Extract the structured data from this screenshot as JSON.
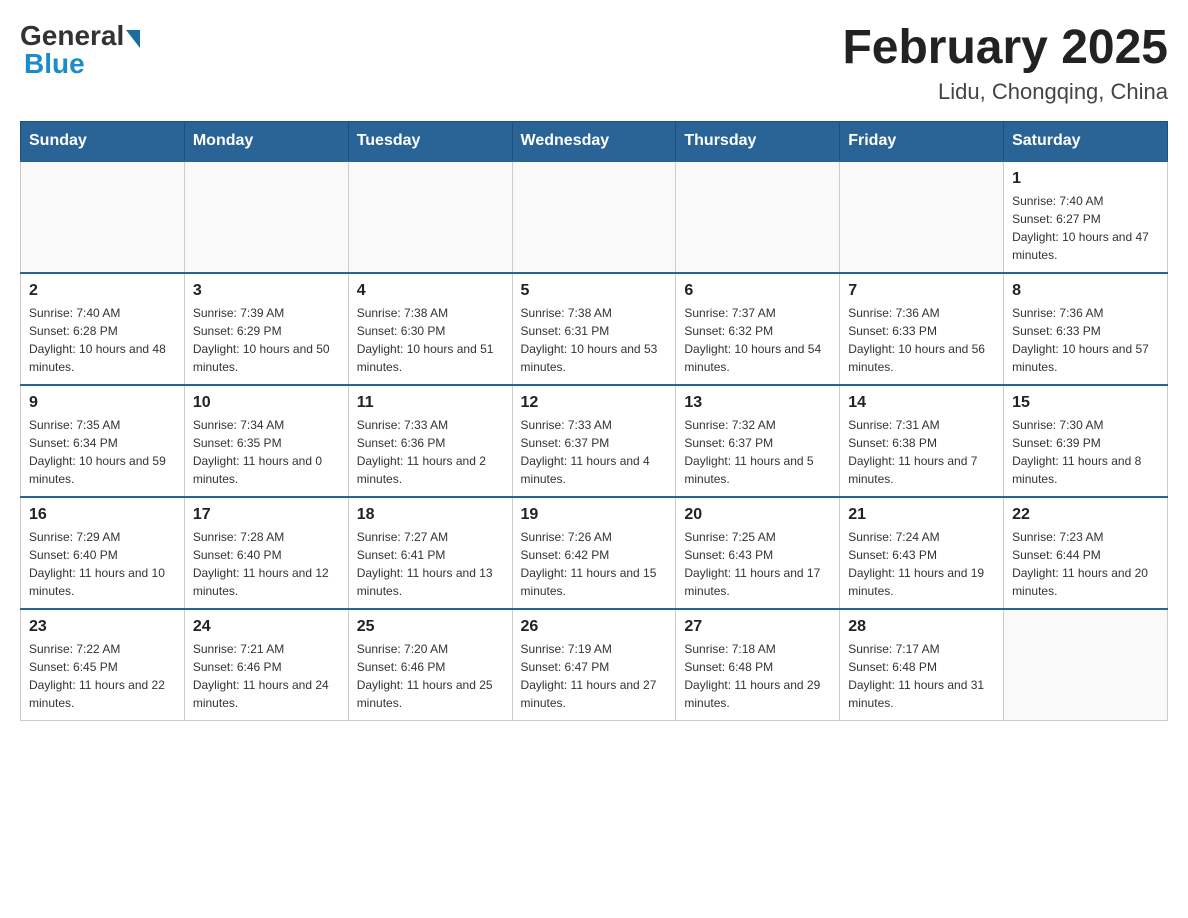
{
  "header": {
    "logo_general": "General",
    "logo_blue": "Blue",
    "month_title": "February 2025",
    "location": "Lidu, Chongqing, China"
  },
  "days_of_week": [
    "Sunday",
    "Monday",
    "Tuesday",
    "Wednesday",
    "Thursday",
    "Friday",
    "Saturday"
  ],
  "weeks": [
    [
      {
        "day": "",
        "sunrise": "",
        "sunset": "",
        "daylight": ""
      },
      {
        "day": "",
        "sunrise": "",
        "sunset": "",
        "daylight": ""
      },
      {
        "day": "",
        "sunrise": "",
        "sunset": "",
        "daylight": ""
      },
      {
        "day": "",
        "sunrise": "",
        "sunset": "",
        "daylight": ""
      },
      {
        "day": "",
        "sunrise": "",
        "sunset": "",
        "daylight": ""
      },
      {
        "day": "",
        "sunrise": "",
        "sunset": "",
        "daylight": ""
      },
      {
        "day": "1",
        "sunrise": "Sunrise: 7:40 AM",
        "sunset": "Sunset: 6:27 PM",
        "daylight": "Daylight: 10 hours and 47 minutes."
      }
    ],
    [
      {
        "day": "2",
        "sunrise": "Sunrise: 7:40 AM",
        "sunset": "Sunset: 6:28 PM",
        "daylight": "Daylight: 10 hours and 48 minutes."
      },
      {
        "day": "3",
        "sunrise": "Sunrise: 7:39 AM",
        "sunset": "Sunset: 6:29 PM",
        "daylight": "Daylight: 10 hours and 50 minutes."
      },
      {
        "day": "4",
        "sunrise": "Sunrise: 7:38 AM",
        "sunset": "Sunset: 6:30 PM",
        "daylight": "Daylight: 10 hours and 51 minutes."
      },
      {
        "day": "5",
        "sunrise": "Sunrise: 7:38 AM",
        "sunset": "Sunset: 6:31 PM",
        "daylight": "Daylight: 10 hours and 53 minutes."
      },
      {
        "day": "6",
        "sunrise": "Sunrise: 7:37 AM",
        "sunset": "Sunset: 6:32 PM",
        "daylight": "Daylight: 10 hours and 54 minutes."
      },
      {
        "day": "7",
        "sunrise": "Sunrise: 7:36 AM",
        "sunset": "Sunset: 6:33 PM",
        "daylight": "Daylight: 10 hours and 56 minutes."
      },
      {
        "day": "8",
        "sunrise": "Sunrise: 7:36 AM",
        "sunset": "Sunset: 6:33 PM",
        "daylight": "Daylight: 10 hours and 57 minutes."
      }
    ],
    [
      {
        "day": "9",
        "sunrise": "Sunrise: 7:35 AM",
        "sunset": "Sunset: 6:34 PM",
        "daylight": "Daylight: 10 hours and 59 minutes."
      },
      {
        "day": "10",
        "sunrise": "Sunrise: 7:34 AM",
        "sunset": "Sunset: 6:35 PM",
        "daylight": "Daylight: 11 hours and 0 minutes."
      },
      {
        "day": "11",
        "sunrise": "Sunrise: 7:33 AM",
        "sunset": "Sunset: 6:36 PM",
        "daylight": "Daylight: 11 hours and 2 minutes."
      },
      {
        "day": "12",
        "sunrise": "Sunrise: 7:33 AM",
        "sunset": "Sunset: 6:37 PM",
        "daylight": "Daylight: 11 hours and 4 minutes."
      },
      {
        "day": "13",
        "sunrise": "Sunrise: 7:32 AM",
        "sunset": "Sunset: 6:37 PM",
        "daylight": "Daylight: 11 hours and 5 minutes."
      },
      {
        "day": "14",
        "sunrise": "Sunrise: 7:31 AM",
        "sunset": "Sunset: 6:38 PM",
        "daylight": "Daylight: 11 hours and 7 minutes."
      },
      {
        "day": "15",
        "sunrise": "Sunrise: 7:30 AM",
        "sunset": "Sunset: 6:39 PM",
        "daylight": "Daylight: 11 hours and 8 minutes."
      }
    ],
    [
      {
        "day": "16",
        "sunrise": "Sunrise: 7:29 AM",
        "sunset": "Sunset: 6:40 PM",
        "daylight": "Daylight: 11 hours and 10 minutes."
      },
      {
        "day": "17",
        "sunrise": "Sunrise: 7:28 AM",
        "sunset": "Sunset: 6:40 PM",
        "daylight": "Daylight: 11 hours and 12 minutes."
      },
      {
        "day": "18",
        "sunrise": "Sunrise: 7:27 AM",
        "sunset": "Sunset: 6:41 PM",
        "daylight": "Daylight: 11 hours and 13 minutes."
      },
      {
        "day": "19",
        "sunrise": "Sunrise: 7:26 AM",
        "sunset": "Sunset: 6:42 PM",
        "daylight": "Daylight: 11 hours and 15 minutes."
      },
      {
        "day": "20",
        "sunrise": "Sunrise: 7:25 AM",
        "sunset": "Sunset: 6:43 PM",
        "daylight": "Daylight: 11 hours and 17 minutes."
      },
      {
        "day": "21",
        "sunrise": "Sunrise: 7:24 AM",
        "sunset": "Sunset: 6:43 PM",
        "daylight": "Daylight: 11 hours and 19 minutes."
      },
      {
        "day": "22",
        "sunrise": "Sunrise: 7:23 AM",
        "sunset": "Sunset: 6:44 PM",
        "daylight": "Daylight: 11 hours and 20 minutes."
      }
    ],
    [
      {
        "day": "23",
        "sunrise": "Sunrise: 7:22 AM",
        "sunset": "Sunset: 6:45 PM",
        "daylight": "Daylight: 11 hours and 22 minutes."
      },
      {
        "day": "24",
        "sunrise": "Sunrise: 7:21 AM",
        "sunset": "Sunset: 6:46 PM",
        "daylight": "Daylight: 11 hours and 24 minutes."
      },
      {
        "day": "25",
        "sunrise": "Sunrise: 7:20 AM",
        "sunset": "Sunset: 6:46 PM",
        "daylight": "Daylight: 11 hours and 25 minutes."
      },
      {
        "day": "26",
        "sunrise": "Sunrise: 7:19 AM",
        "sunset": "Sunset: 6:47 PM",
        "daylight": "Daylight: 11 hours and 27 minutes."
      },
      {
        "day": "27",
        "sunrise": "Sunrise: 7:18 AM",
        "sunset": "Sunset: 6:48 PM",
        "daylight": "Daylight: 11 hours and 29 minutes."
      },
      {
        "day": "28",
        "sunrise": "Sunrise: 7:17 AM",
        "sunset": "Sunset: 6:48 PM",
        "daylight": "Daylight: 11 hours and 31 minutes."
      },
      {
        "day": "",
        "sunrise": "",
        "sunset": "",
        "daylight": ""
      }
    ]
  ]
}
